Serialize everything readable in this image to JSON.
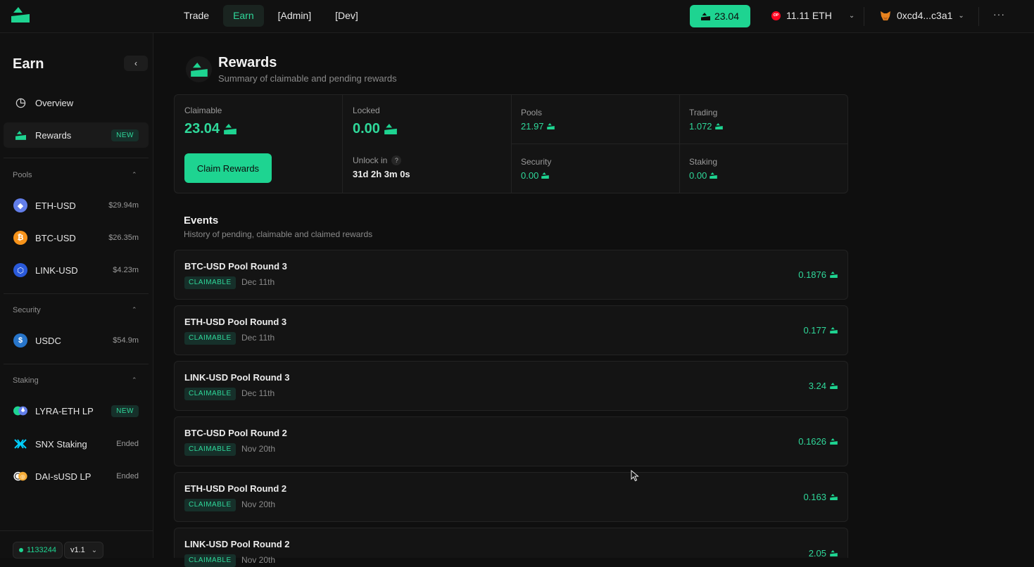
{
  "header": {
    "nav": [
      "Trade",
      "Earn",
      "[Admin]",
      "[Dev]"
    ],
    "active_nav": "Earn",
    "balance": "23.04",
    "network_balance": "11.11 ETH",
    "network_badge": "OP",
    "wallet": "0xcd4...c3a1",
    "more": "···"
  },
  "sidebar": {
    "title": "Earn",
    "collapse": "‹",
    "top_items": [
      {
        "label": "Overview"
      },
      {
        "label": "Rewards",
        "badge": "NEW"
      }
    ],
    "pools": {
      "title": "Pools",
      "items": [
        {
          "label": "ETH-USD",
          "value": "$29.94m"
        },
        {
          "label": "BTC-USD",
          "value": "$26.35m"
        },
        {
          "label": "LINK-USD",
          "value": "$4.23m"
        }
      ]
    },
    "security": {
      "title": "Security",
      "items": [
        {
          "label": "USDC",
          "value": "$54.9m"
        }
      ]
    },
    "staking": {
      "title": "Staking",
      "items": [
        {
          "label": "LYRA-ETH LP",
          "badge": "NEW"
        },
        {
          "label": "SNX Staking",
          "value": "Ended"
        },
        {
          "label": "DAI-sUSD LP",
          "value": "Ended"
        }
      ]
    },
    "footer": {
      "block": "1133244",
      "version": "v1.1"
    }
  },
  "page": {
    "title": "Rewards",
    "subtitle": "Summary of claimable and pending rewards"
  },
  "summary": {
    "claimable_label": "Claimable",
    "claimable_value": "23.04",
    "claim_button": "Claim Rewards",
    "locked_label": "Locked",
    "locked_value": "0.00",
    "unlock_label": "Unlock in",
    "unlock_help": "?",
    "unlock_value": "31d 2h 3m 0s",
    "pools_label": "Pools",
    "pools_value": "21.97",
    "trading_label": "Trading",
    "trading_value": "1.072",
    "security_label": "Security",
    "security_value": "0.00",
    "staking_label": "Staking",
    "staking_value": "0.00"
  },
  "events": {
    "title": "Events",
    "subtitle": "History of pending, claimable and claimed rewards",
    "items": [
      {
        "name": "BTC-USD Pool Round 3",
        "status": "CLAIMABLE",
        "date": "Dec 11th",
        "amount": "0.1876"
      },
      {
        "name": "ETH-USD Pool Round 3",
        "status": "CLAIMABLE",
        "date": "Dec 11th",
        "amount": "0.177"
      },
      {
        "name": "LINK-USD Pool Round 3",
        "status": "CLAIMABLE",
        "date": "Dec 11th",
        "amount": "3.24"
      },
      {
        "name": "BTC-USD Pool Round 2",
        "status": "CLAIMABLE",
        "date": "Nov 20th",
        "amount": "0.1626"
      },
      {
        "name": "ETH-USD Pool Round 2",
        "status": "CLAIMABLE",
        "date": "Nov 20th",
        "amount": "0.163"
      },
      {
        "name": "LINK-USD Pool Round 2",
        "status": "CLAIMABLE",
        "date": "Nov 20th",
        "amount": "2.05"
      }
    ]
  },
  "colors": {
    "accent": "#1ed491",
    "background": "#0f0f0f",
    "badge_bg": "#16302a"
  }
}
